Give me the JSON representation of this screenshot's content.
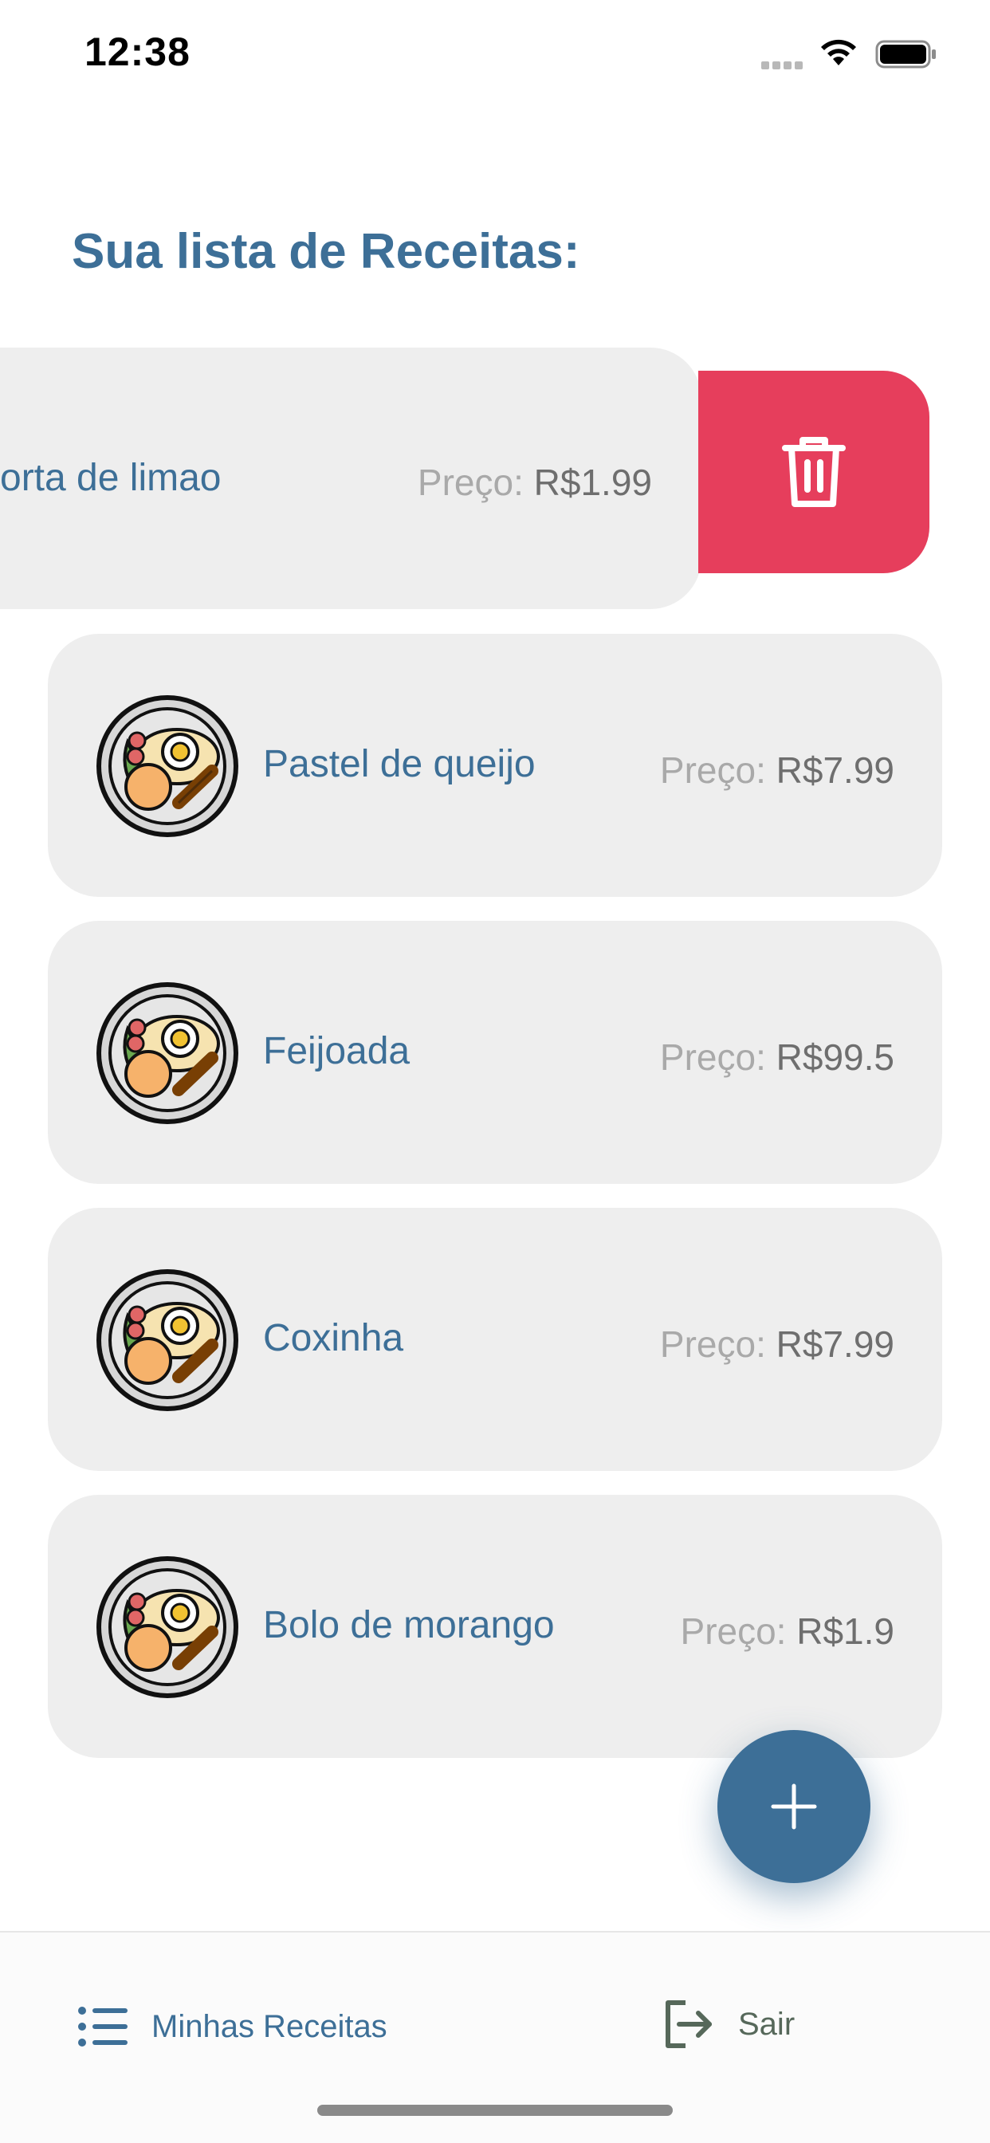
{
  "status_bar": {
    "time": "12:38",
    "icons": [
      "signal-icon",
      "wifi-icon",
      "battery-icon"
    ]
  },
  "page": {
    "title": "Sua lista de Receitas:"
  },
  "swiped_item": {
    "name": "orta de limao",
    "price_label": "Preço:",
    "price_value": "R$1.99",
    "delete_icon": "trash-icon"
  },
  "recipes": [
    {
      "name": "Pastel de queijo",
      "price_label": "Preço:",
      "price_value": "R$7.99",
      "icon": "food-plate-icon"
    },
    {
      "name": "Feijoada",
      "price_label": "Preço:",
      "price_value": "R$99.5",
      "icon": "food-plate-icon"
    },
    {
      "name": "Coxinha",
      "price_label": "Preço:",
      "price_value": "R$7.99",
      "icon": "food-plate-icon"
    },
    {
      "name": "Bolo de morango",
      "price_label": "Preço:",
      "price_value": "R$1.9",
      "icon": "food-plate-icon"
    }
  ],
  "fab": {
    "icon": "plus-icon"
  },
  "tab_bar": {
    "items": [
      {
        "label": "Minhas Receitas",
        "icon": "list-icon",
        "active": true
      },
      {
        "label": "Sair",
        "icon": "logout-icon",
        "active": false
      }
    ]
  },
  "colors": {
    "primary": "#3d6f97",
    "delete": "#e63e5c",
    "card_bg": "#eeeeee",
    "price_label": "#a9a9a9",
    "price_value": "#6e6e6e",
    "logout": "#56685a"
  }
}
